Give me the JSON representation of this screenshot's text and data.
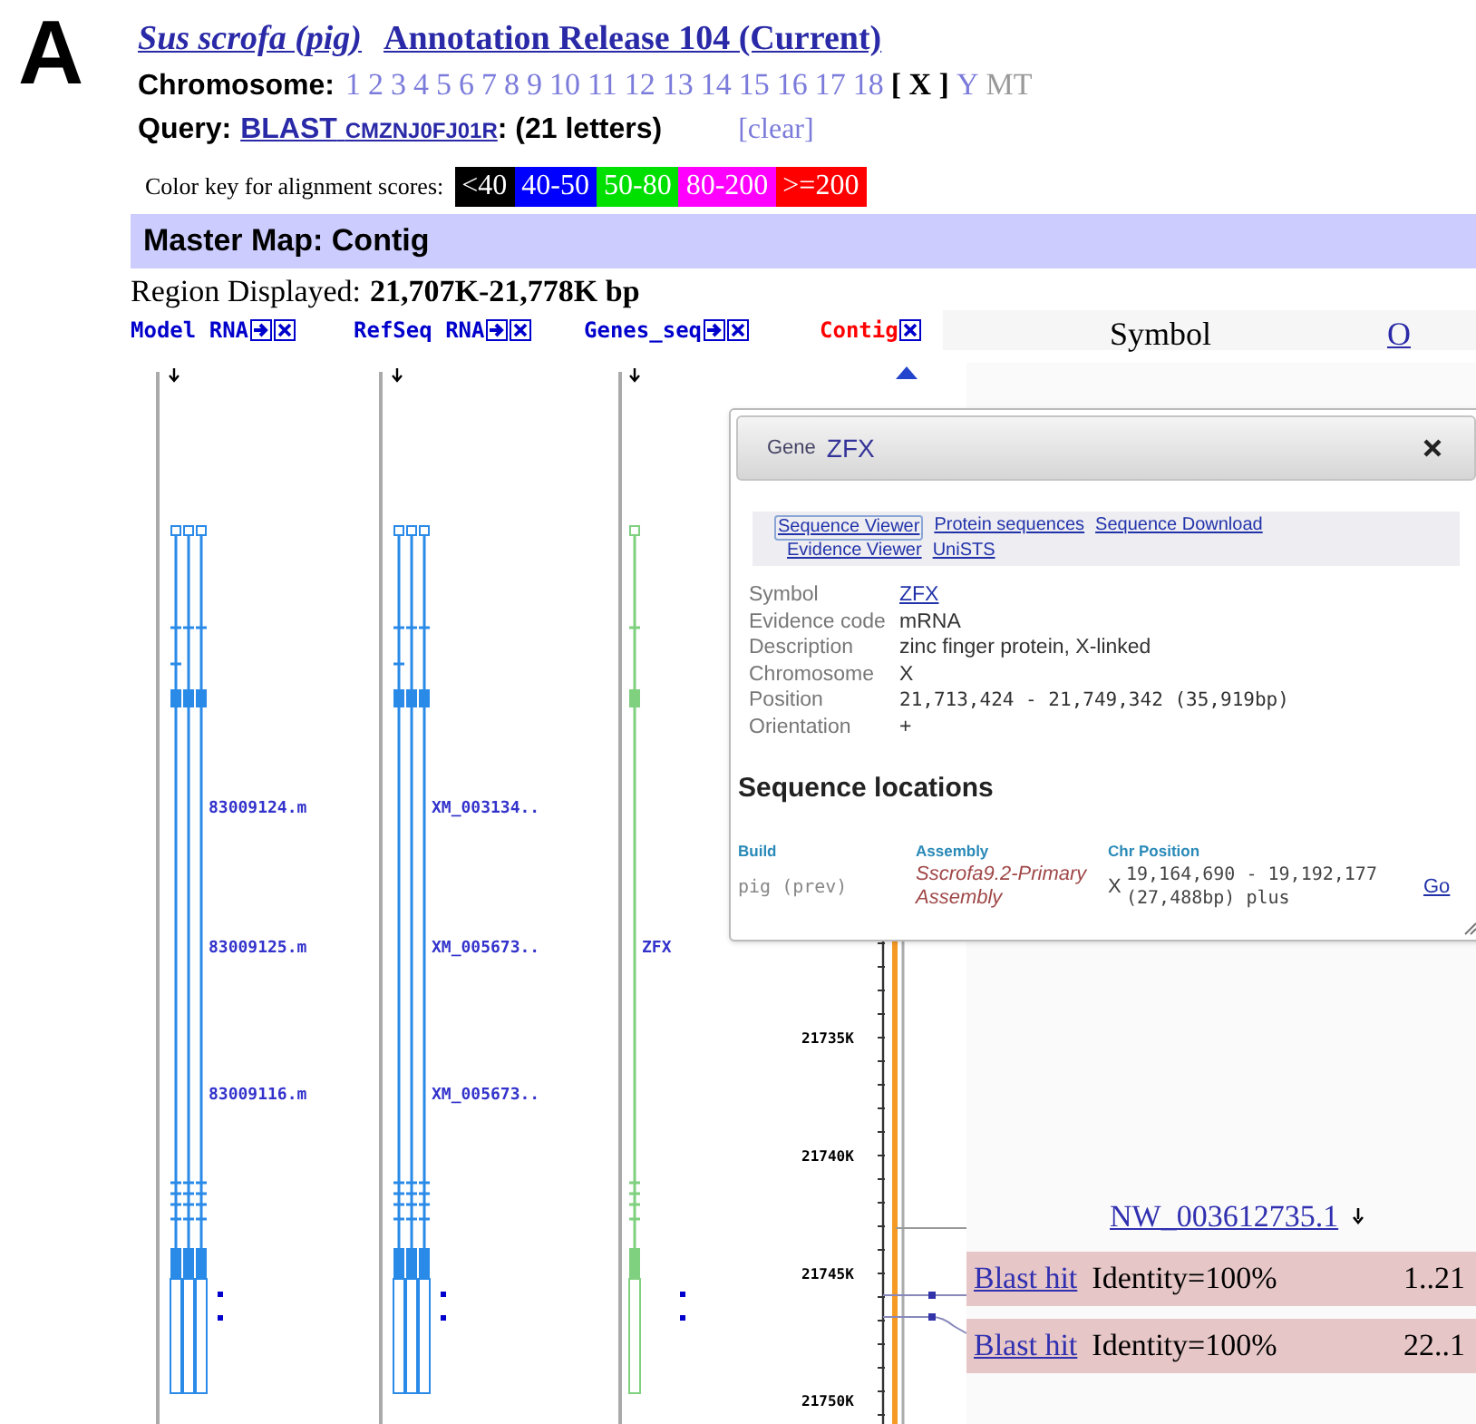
{
  "panel_label": "A",
  "title": {
    "species": "Sus scrofa (pig)",
    "release": "Annotation Release 104 (Current)"
  },
  "chromosome": {
    "label": "Chromosome:",
    "items": [
      {
        "label": "1",
        "selected": false,
        "disabled": false
      },
      {
        "label": "2",
        "selected": false,
        "disabled": false
      },
      {
        "label": "3",
        "selected": false,
        "disabled": false
      },
      {
        "label": "4",
        "selected": false,
        "disabled": false
      },
      {
        "label": "5",
        "selected": false,
        "disabled": false
      },
      {
        "label": "6",
        "selected": false,
        "disabled": false
      },
      {
        "label": "7",
        "selected": false,
        "disabled": false
      },
      {
        "label": "8",
        "selected": false,
        "disabled": false
      },
      {
        "label": "9",
        "selected": false,
        "disabled": false
      },
      {
        "label": "10",
        "selected": false,
        "disabled": false
      },
      {
        "label": "11",
        "selected": false,
        "disabled": false
      },
      {
        "label": "12",
        "selected": false,
        "disabled": false
      },
      {
        "label": "13",
        "selected": false,
        "disabled": false
      },
      {
        "label": "14",
        "selected": false,
        "disabled": false
      },
      {
        "label": "15",
        "selected": false,
        "disabled": false
      },
      {
        "label": "16",
        "selected": false,
        "disabled": false
      },
      {
        "label": "17",
        "selected": false,
        "disabled": false
      },
      {
        "label": "18",
        "selected": false,
        "disabled": false
      },
      {
        "label": "[ X ]",
        "selected": true,
        "disabled": false
      },
      {
        "label": "Y",
        "selected": false,
        "disabled": false
      },
      {
        "label": "MT",
        "selected": false,
        "disabled": true
      }
    ]
  },
  "query": {
    "label": "Query:",
    "link": "BLAST",
    "link_id": "CMZNJ0FJ01R",
    "letters": ": (21 letters)",
    "clear": "[clear]"
  },
  "color_key": {
    "label": "Color key for alignment scores:",
    "items": [
      {
        "label": "<40",
        "color": "#000000"
      },
      {
        "label": "40-50",
        "color": "#0000ff"
      },
      {
        "label": "50-80",
        "color": "#00e000"
      },
      {
        "label": "80-200",
        "color": "#ff00ff"
      },
      {
        "label": ">=200",
        "color": "#ff0000"
      }
    ]
  },
  "master_map": {
    "title": "Master Map: Contig"
  },
  "region": {
    "label": "Region Displayed:",
    "value": "21,707K-21,778K bp"
  },
  "tracks": [
    {
      "name": "Model RNA",
      "kind": "rna",
      "color": "#0000cc",
      "genes": [
        "83009124.m",
        "83009125.m",
        "83009116.m"
      ]
    },
    {
      "name": "RefSeq RNA",
      "kind": "rna",
      "color": "#0000cc",
      "genes": [
        "XM_003134..",
        "XM_005673..",
        "XM_005673.."
      ]
    },
    {
      "name": "Genes_seq",
      "kind": "gene",
      "color": "#0000cc",
      "genes": [
        "ZFX"
      ]
    },
    {
      "name": "Contig",
      "kind": "contig",
      "color": "#ff0000"
    }
  ],
  "ruler": {
    "ticks": [
      "21735K",
      "21740K",
      "21745K",
      "21750K"
    ]
  },
  "columns": {
    "symbol": "Symbol",
    "column_2": "O"
  },
  "contig_link": "NW_003612735.1",
  "blast_hits": [
    {
      "link": "Blast hit",
      "identity": "Identity=100%",
      "range": "1..21"
    },
    {
      "link": "Blast hit",
      "identity": "Identity=100%",
      "range": "22..1"
    }
  ],
  "popup": {
    "type_label": "Gene",
    "title": "ZFX",
    "link_rows": [
      [
        {
          "label": "Sequence Viewer",
          "selected": true
        },
        {
          "label": "Protein sequences",
          "selected": false
        },
        {
          "label": "Sequence Download",
          "selected": false
        }
      ],
      [
        {
          "label": "Evidence Viewer",
          "selected": false
        },
        {
          "label": "UniSTS",
          "selected": false
        }
      ]
    ],
    "details": [
      {
        "label": "Symbol",
        "value": "ZFX",
        "kind": "link"
      },
      {
        "label": "Evidence code",
        "value": "mRNA",
        "kind": "text"
      },
      {
        "label": "Description",
        "value": "zinc finger protein, X-linked",
        "kind": "text"
      },
      {
        "label": "Chromosome",
        "value": "X",
        "kind": "text"
      },
      {
        "label": "Position",
        "value": "21,713,424 - 21,749,342 (35,919bp)",
        "kind": "mono"
      },
      {
        "label": "Orientation",
        "value": "+",
        "kind": "text"
      }
    ],
    "section_title": "Sequence locations",
    "table": {
      "columns": [
        "Build",
        "Assembly",
        "Chr Position"
      ],
      "rows": [
        {
          "build": "pig (prev)",
          "assembly": "Sscrofa9.2-Primary Assembly",
          "chr": "X",
          "position": "19,164,690 - 19,192,177 (27,488bp) plus",
          "action": "Go"
        }
      ]
    }
  }
}
